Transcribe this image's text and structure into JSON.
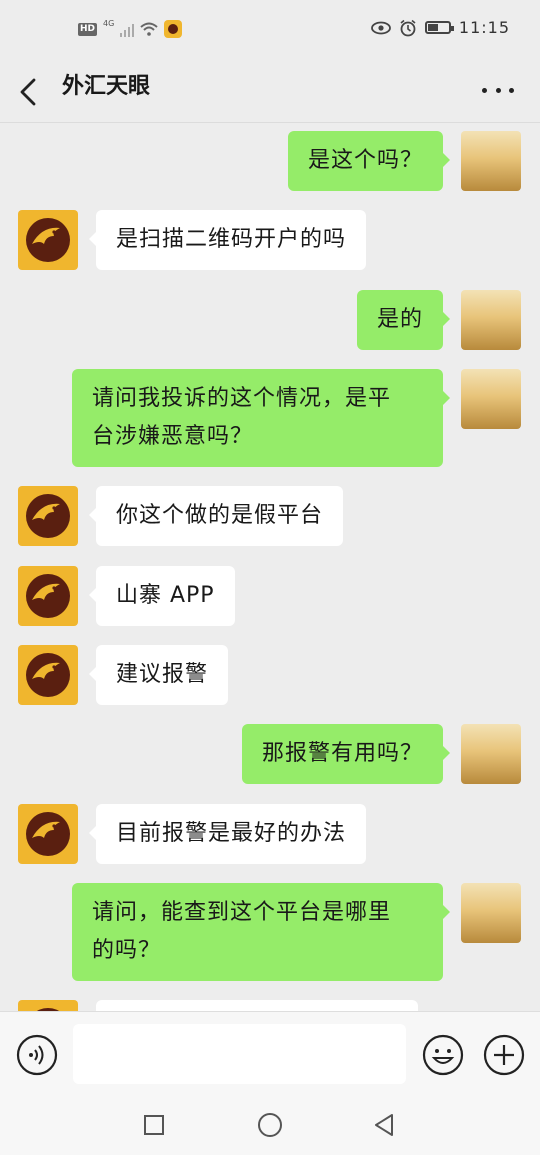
{
  "status_bar": {
    "hd": "HD",
    "network": "4G",
    "time": "11:15",
    "icons": [
      "signal-icon",
      "wifi-icon",
      "app-notification-icon",
      "eye-icon",
      "alarm-icon",
      "battery-icon"
    ]
  },
  "header": {
    "title": "外汇天眼",
    "icons": [
      "back-icon",
      "more-icon"
    ]
  },
  "messages": [
    {
      "sender": "me",
      "text": "是这个吗？"
    },
    {
      "sender": "bot",
      "text": "是扫描二维码开户的吗"
    },
    {
      "sender": "me",
      "text": "是的"
    },
    {
      "sender": "me",
      "text": "请问我投诉的这个情况，是平\n台涉嫌恶意吗？"
    },
    {
      "sender": "bot",
      "text": "你这个做的是假平台"
    },
    {
      "sender": "bot",
      "text": "山寨 APP"
    },
    {
      "sender": "bot",
      "text": "建议报警"
    },
    {
      "sender": "me",
      "text": "那报警有用吗？"
    },
    {
      "sender": "bot",
      "text": "目前报警是最好的办法"
    },
    {
      "sender": "me",
      "text": "请问，能查到这个平台是哪里\n的吗？"
    },
    {
      "sender": "bot",
      "text": ""
    }
  ],
  "input_bar": {
    "value": "",
    "icons": [
      "voice-icon",
      "emoji-icon",
      "plus-icon"
    ]
  },
  "nav_bar": {
    "icons": [
      "recent-apps-icon",
      "home-icon",
      "back-nav-icon"
    ]
  },
  "colors": {
    "background": "#ededed",
    "my_bubble": "#95ec69",
    "their_bubble": "#ffffff",
    "brand_avatar": "#f0b62e"
  }
}
